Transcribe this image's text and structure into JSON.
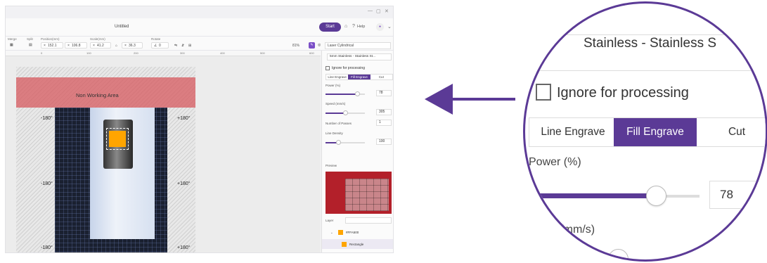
{
  "app": {
    "doc_title": "Untitled",
    "start_label": "Start",
    "help_label": "Help",
    "toolbar": {
      "merge_label": "Merge",
      "split_label": "Split",
      "position_label": "Position(mm)",
      "pos_x": "152.1",
      "pos_y": "106.8",
      "scale_label": "Scale(mm)",
      "scale_w": "41.2",
      "scale_h": "36.3",
      "rotate_label": "Rotate",
      "rotate_val": "0",
      "zoom": "81%",
      "laser": "Laser Cylindrical"
    },
    "ruler": [
      "0",
      "100",
      "200",
      "300",
      "400",
      "600"
    ],
    "canvas": {
      "non_working_area": "Non Working Area",
      "degree_labels": [
        "-180°",
        "+180°",
        "-180°",
        "+180°",
        "-180°",
        "+180°"
      ]
    },
    "panel": {
      "material": "5mm Stainless - Stainless St...",
      "ignore_label": "Ignore for processing",
      "tabs": [
        "Line Engrave",
        "Fill Engrave",
        "Cut"
      ],
      "active_tab": "Fill Engrave",
      "power_label": "Power (%)",
      "power_value": "78",
      "speed_label": "Speed (mm/s)",
      "speed_value": "305",
      "passes_label": "Number of Passes",
      "passes_value": "1",
      "density_label": "Line Density",
      "density_value": "100",
      "preview_label": "Preview",
      "layer_label": "Layer",
      "layer_color": "#FFA500",
      "layer_item": "Rectangle"
    }
  },
  "zoom": {
    "material": "Stainless - Stainless S",
    "ignore_label": "Ignore for processing",
    "tabs": [
      "Line Engrave",
      "Fill Engrave",
      "Cut"
    ],
    "power_label": "Power (%)",
    "power_value": "78",
    "speed_label": "d (mm/s)"
  },
  "colors": {
    "accent": "#5b3a96",
    "layer": "#ffa500",
    "non_working": "#d75a5f"
  },
  "power_fraction": 0.78
}
